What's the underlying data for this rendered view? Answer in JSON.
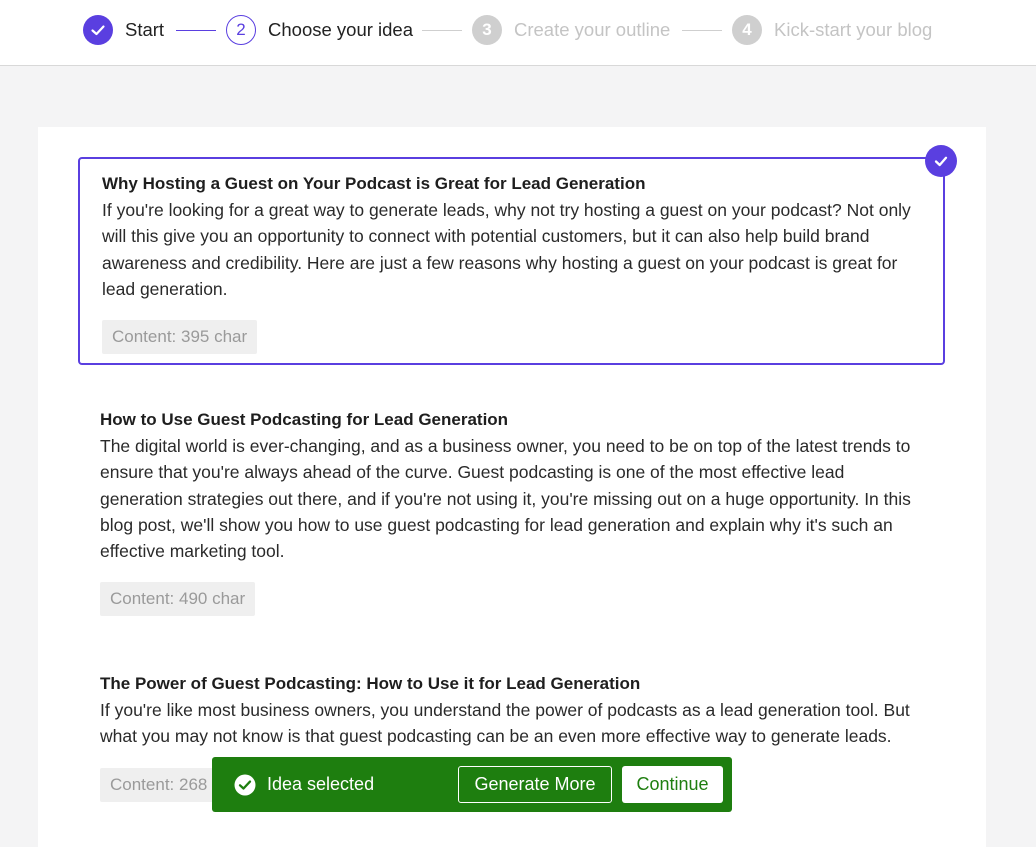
{
  "stepper": {
    "steps": [
      {
        "number": "",
        "label": "Start",
        "state": "done"
      },
      {
        "number": "2",
        "label": "Choose your idea",
        "state": "current"
      },
      {
        "number": "3",
        "label": "Create your outline",
        "state": "todo"
      },
      {
        "number": "4",
        "label": "Kick-start your blog",
        "state": "todo"
      }
    ]
  },
  "ideas": [
    {
      "title": "Why Hosting a Guest on Your Podcast is Great for Lead Generation",
      "body": "If you're looking for a great way to generate leads, why not try hosting a guest on your podcast? Not only will this give you an opportunity to connect with potential customers, but it can also help build brand awareness and credibility. Here are just a few reasons why hosting a guest on your podcast is great for lead generation.",
      "content": "Content: 395 char",
      "selected": true
    },
    {
      "title": "How to Use Guest Podcasting for Lead Generation",
      "body": "The digital world is ever-changing, and as a business owner, you need to be on top of the latest trends to ensure that you're always ahead of the curve. Guest podcasting is one of the most effective lead generation strategies out there, and if you're not using it, you're missing out on a huge opportunity. In this blog post, we'll show you how to use guest podcasting for lead generation and explain why it's such an effective marketing tool.",
      "content": "Content: 490 char",
      "selected": false
    },
    {
      "title": "The Power of Guest Podcasting: How to Use it for Lead Generation",
      "body": "If you're like most business owners, you understand the power of podcasts as a lead generation tool. But what you may not know is that guest podcasting can be an even more effective way to generate leads.",
      "content": "Content: 268 char",
      "selected": false
    }
  ],
  "toast": {
    "message": "Idea selected",
    "generate_more_label": "Generate More",
    "continue_label": "Continue"
  },
  "colors": {
    "accent": "#5a3fe0",
    "success": "#1e7e0f",
    "inactive": "#cfcfcf"
  }
}
